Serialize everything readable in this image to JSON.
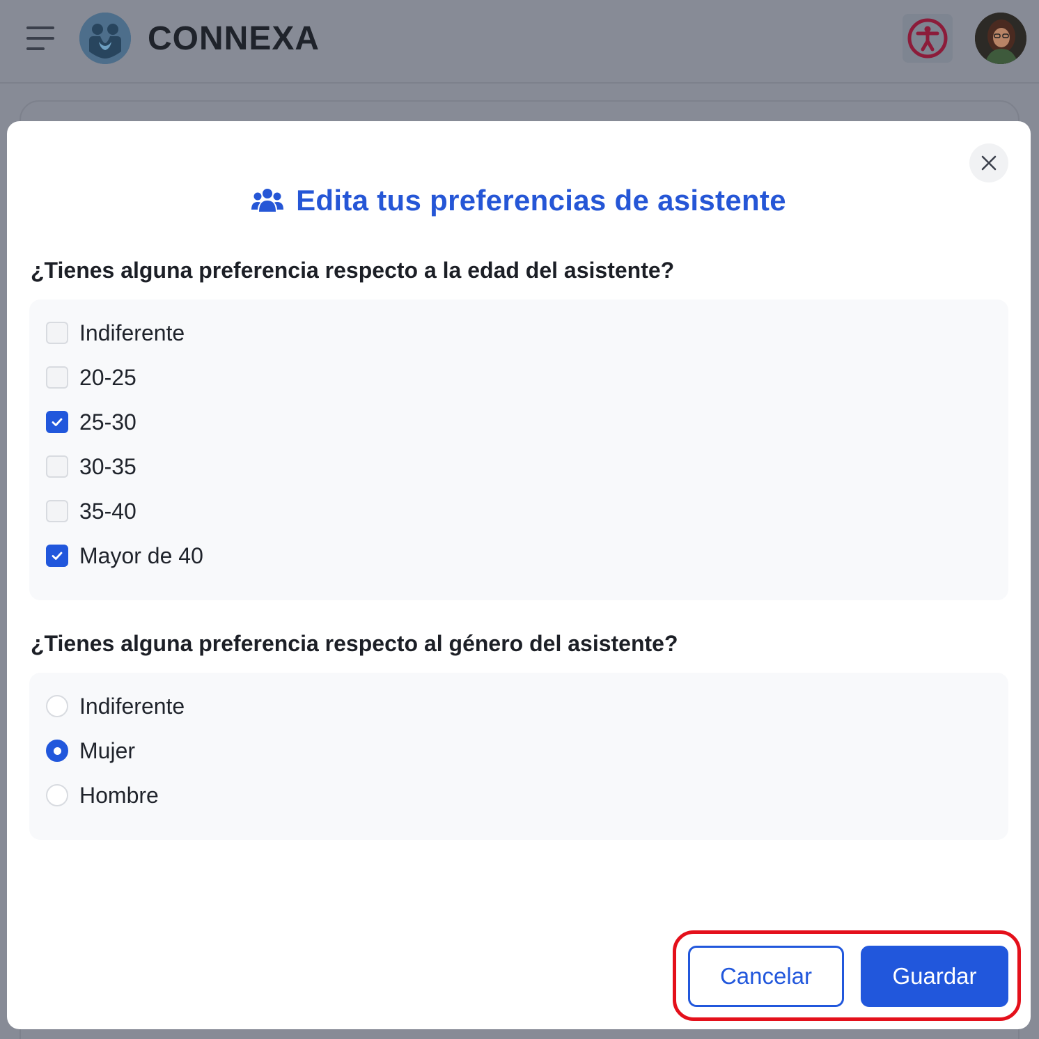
{
  "header": {
    "brand": "CONNEXA",
    "menu_icon": "hamburger-menu-icon",
    "logo_icon": "connexa-logo-icon",
    "accessibility_icon": "accessibility-icon",
    "avatar": "user-avatar"
  },
  "modal": {
    "title": "Edita tus preferencias de asistente",
    "title_icon": "users-icon",
    "close_icon": "close-icon",
    "age_question": "¿Tienes alguna preferencia respecto a la edad del asistente?",
    "age_options": [
      {
        "label": "Indiferente",
        "checked": false
      },
      {
        "label": "20-25",
        "checked": false
      },
      {
        "label": "25-30",
        "checked": true
      },
      {
        "label": "30-35",
        "checked": false
      },
      {
        "label": "35-40",
        "checked": false
      },
      {
        "label": "Mayor de 40",
        "checked": true
      }
    ],
    "gender_question": "¿Tienes alguna preferencia respecto al género del asistente?",
    "gender_options": [
      {
        "label": "Indiferente",
        "selected": false
      },
      {
        "label": "Mujer",
        "selected": true
      },
      {
        "label": "Hombre",
        "selected": false
      }
    ],
    "cancel_label": "Cancelar",
    "save_label": "Guardar"
  },
  "colors": {
    "primary": "#2157dc",
    "title": "#2556d6",
    "overlay": "#878b96",
    "highlight": "#e4101b",
    "accessibility": "#8c1c3a"
  }
}
